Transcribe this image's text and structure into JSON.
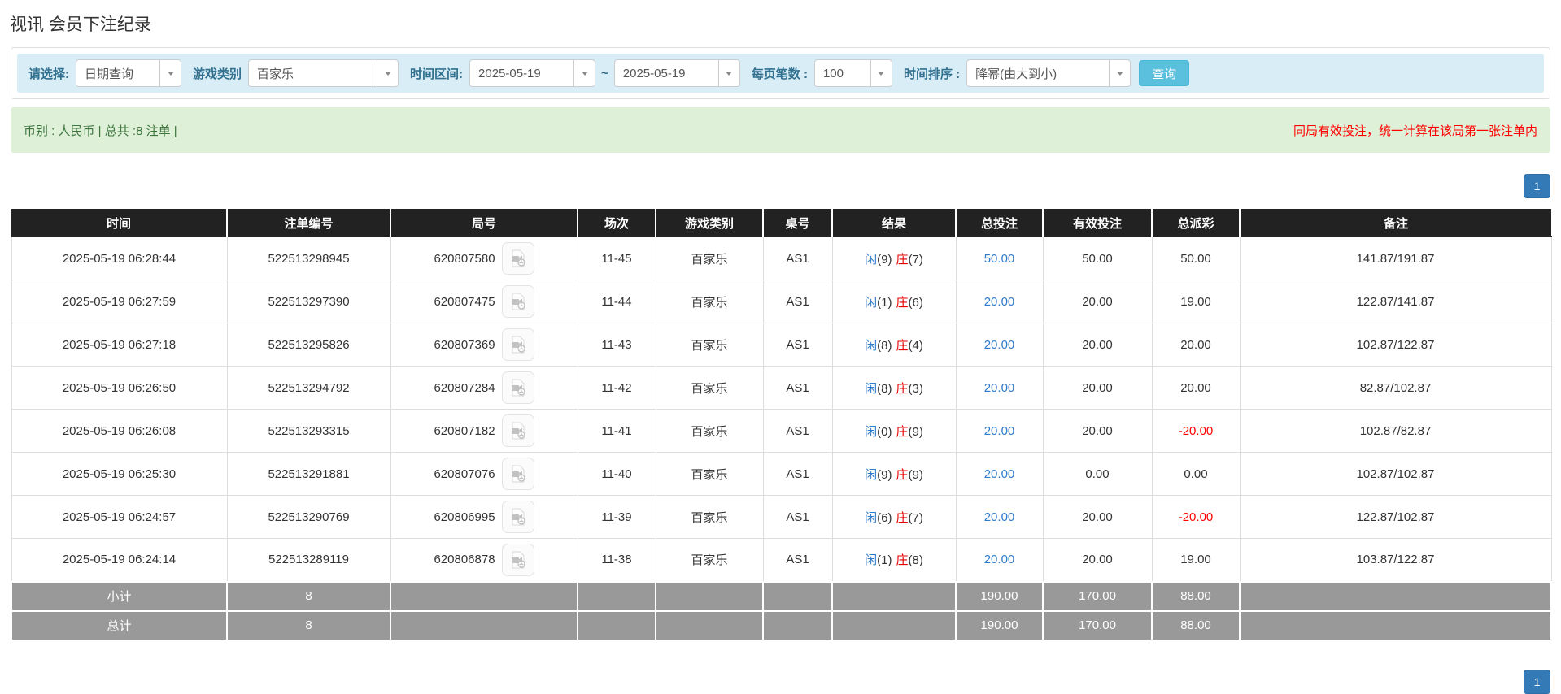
{
  "page": {
    "title": "视讯 会员下注纪录"
  },
  "filter": {
    "select_label": "请选择:",
    "query_type": "日期查询",
    "game_label": "游戏类别",
    "game_type": "百家乐",
    "range_label": "时间区间:",
    "date_from": "2025-05-19",
    "tilde": "~",
    "date_to": "2025-05-19",
    "per_page_label": "每页笔数 :",
    "per_page": "100",
    "sort_label": "时间排序 :",
    "sort_order": "降幂(由大到小)",
    "search_button": "查询"
  },
  "summary": {
    "currency_info": "币别 : 人民币 | 总共 :8 注单 |",
    "notice": "同局有效投注，统一计算在该局第一张注单内"
  },
  "pagination": {
    "page": "1"
  },
  "table": {
    "headers": [
      "时间",
      "注单编号",
      "局号",
      "场次",
      "游戏类别",
      "桌号",
      "结果",
      "总投注",
      "有效投注",
      "总派彩",
      "备注"
    ],
    "video_icon": "video-file-icon",
    "rows": [
      {
        "time": "2025-05-19 06:28:44",
        "bet_id": "522513298945",
        "round_id": "620807580",
        "session": "11-45",
        "game": "百家乐",
        "table_no": "AS1",
        "player_label": "闲",
        "player_score": "(9)",
        "banker_label": "庄",
        "banker_score": "(7)",
        "total_bet": "50.00",
        "valid_bet": "50.00",
        "payout": "50.00",
        "remark": "141.87/191.87"
      },
      {
        "time": "2025-05-19 06:27:59",
        "bet_id": "522513297390",
        "round_id": "620807475",
        "session": "11-44",
        "game": "百家乐",
        "table_no": "AS1",
        "player_label": "闲",
        "player_score": "(1)",
        "banker_label": "庄",
        "banker_score": "(6)",
        "total_bet": "20.00",
        "valid_bet": "20.00",
        "payout": "19.00",
        "remark": "122.87/141.87"
      },
      {
        "time": "2025-05-19 06:27:18",
        "bet_id": "522513295826",
        "round_id": "620807369",
        "session": "11-43",
        "game": "百家乐",
        "table_no": "AS1",
        "player_label": "闲",
        "player_score": "(8)",
        "banker_label": "庄",
        "banker_score": "(4)",
        "total_bet": "20.00",
        "valid_bet": "20.00",
        "payout": "20.00",
        "remark": "102.87/122.87"
      },
      {
        "time": "2025-05-19 06:26:50",
        "bet_id": "522513294792",
        "round_id": "620807284",
        "session": "11-42",
        "game": "百家乐",
        "table_no": "AS1",
        "player_label": "闲",
        "player_score": "(8)",
        "banker_label": "庄",
        "banker_score": "(3)",
        "total_bet": "20.00",
        "valid_bet": "20.00",
        "payout": "20.00",
        "remark": "82.87/102.87"
      },
      {
        "time": "2025-05-19 06:26:08",
        "bet_id": "522513293315",
        "round_id": "620807182",
        "session": "11-41",
        "game": "百家乐",
        "table_no": "AS1",
        "player_label": "闲",
        "player_score": "(0)",
        "banker_label": "庄",
        "banker_score": "(9)",
        "total_bet": "20.00",
        "valid_bet": "20.00",
        "payout": "-20.00",
        "remark": "102.87/82.87"
      },
      {
        "time": "2025-05-19 06:25:30",
        "bet_id": "522513291881",
        "round_id": "620807076",
        "session": "11-40",
        "game": "百家乐",
        "table_no": "AS1",
        "player_label": "闲",
        "player_score": "(9)",
        "banker_label": "庄",
        "banker_score": "(9)",
        "total_bet": "20.00",
        "valid_bet": "0.00",
        "payout": "0.00",
        "remark": "102.87/102.87"
      },
      {
        "time": "2025-05-19 06:24:57",
        "bet_id": "522513290769",
        "round_id": "620806995",
        "session": "11-39",
        "game": "百家乐",
        "table_no": "AS1",
        "player_label": "闲",
        "player_score": "(6)",
        "banker_label": "庄",
        "banker_score": "(7)",
        "total_bet": "20.00",
        "valid_bet": "20.00",
        "payout": "-20.00",
        "remark": "122.87/102.87"
      },
      {
        "time": "2025-05-19 06:24:14",
        "bet_id": "522513289119",
        "round_id": "620806878",
        "session": "11-38",
        "game": "百家乐",
        "table_no": "AS1",
        "player_label": "闲",
        "player_score": "(1)",
        "banker_label": "庄",
        "banker_score": "(8)",
        "total_bet": "20.00",
        "valid_bet": "20.00",
        "payout": "19.00",
        "remark": "103.87/122.87"
      }
    ],
    "subtotal": {
      "label": "小计",
      "count": "8",
      "total_bet": "190.00",
      "valid_bet": "170.00",
      "payout": "88.00"
    },
    "total": {
      "label": "总计",
      "count": "8",
      "total_bet": "190.00",
      "valid_bet": "170.00",
      "payout": "88.00"
    }
  },
  "colors": {
    "search_button": "#5bc0de",
    "filter_bar_bg": "#d9edf7",
    "summary_bar_bg": "#dff0d8",
    "notice_red": "#ff0000",
    "link_blue": "#2e7bcc",
    "banker_red": "#e60000",
    "negative_red": "#ff0000",
    "header_bg": "#222222",
    "subtotal_bg": "#999999",
    "pagination_blue": "#337ab7"
  }
}
